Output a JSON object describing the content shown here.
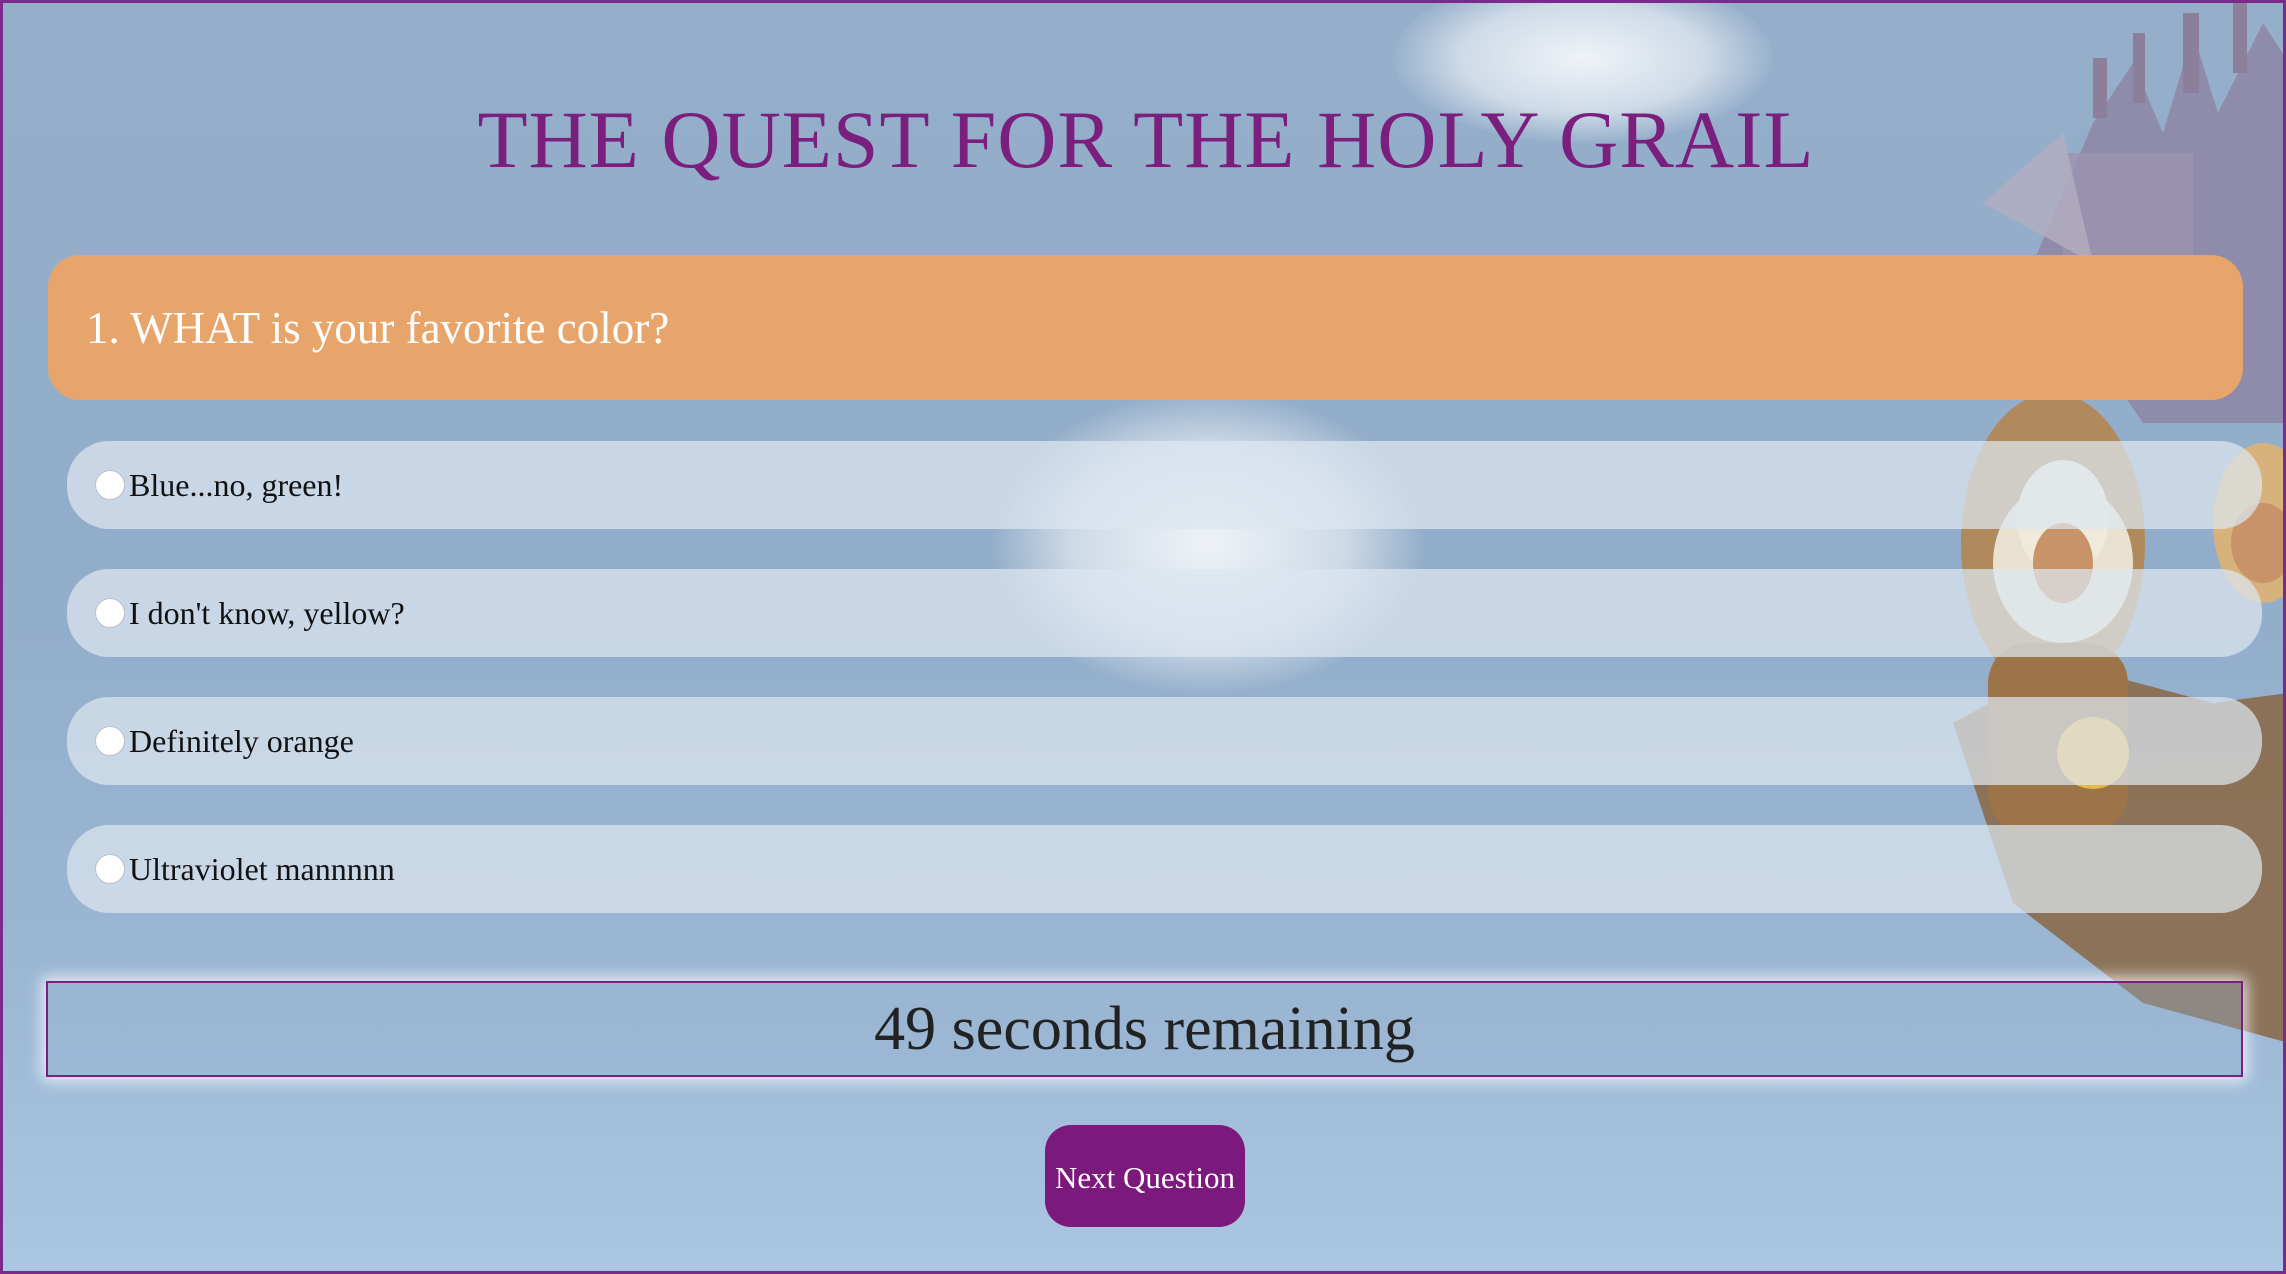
{
  "page": {
    "title": "THE QUEST FOR THE HOLY GRAIL"
  },
  "question": {
    "text": "1. WHAT is your favorite color?"
  },
  "answers": [
    {
      "label": "Blue...no, green!",
      "selected": false
    },
    {
      "label": "I don't know, yellow?",
      "selected": false
    },
    {
      "label": "Definitely orange",
      "selected": false
    },
    {
      "label": "Ultraviolet mannnnn",
      "selected": false
    }
  ],
  "timer": {
    "text": "49 seconds remaining"
  },
  "next_button": {
    "label": "Next Question"
  },
  "colors": {
    "accent": "#7b1f7e",
    "question_bar": "#e8a56b",
    "background": "#92adc9"
  },
  "background_art": {
    "description_icon": "castle-knights-illustration"
  }
}
